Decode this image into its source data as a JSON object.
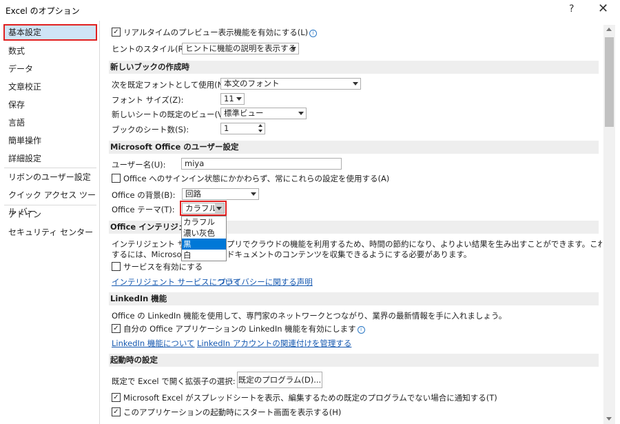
{
  "window": {
    "title": "Excel のオプション",
    "help": "?",
    "close": "✕"
  },
  "sidebar": {
    "items": [
      "基本設定",
      "数式",
      "データ",
      "文章校正",
      "保存",
      "言語",
      "簡単操作",
      "詳細設定",
      "リボンのユーザー設定",
      "クイック アクセス ツール バー",
      "アドイン",
      "セキュリティ センター"
    ],
    "selected": "基本設定"
  },
  "ui_options": {
    "live_preview": "リアルタイムのプレビュー表示機能を有効にする(L)",
    "tooltip_label": "ヒントのスタイル(R):",
    "tooltip_value": "ヒントに機能の説明を表示する"
  },
  "new_workbook": {
    "header": "新しいブックの作成時",
    "font_label": "次を既定フォントとして使用(N):",
    "font_value": "本文のフォント",
    "size_label": "フォント サイズ(Z):",
    "size_value": "11",
    "view_label": "新しいシートの既定のビュー(V):",
    "view_value": "標準ビュー",
    "sheets_label": "ブックのシート数(S):",
    "sheets_value": "1"
  },
  "personalize": {
    "header": "Microsoft Office のユーザー設定",
    "username_label": "ユーザー名(U):",
    "username_value": "miya",
    "always_use": "Office へのサインイン状態にかかわらず、常にこれらの設定を使用する(A)",
    "background_label": "Office の背景(B):",
    "background_value": "回路",
    "theme_label": "Office テーマ(T):",
    "theme_value": "カラフル",
    "theme_options": [
      "カラフル",
      "濃い灰色",
      "黒",
      "白"
    ],
    "theme_highlight": "黒"
  },
  "intelligent": {
    "header": "Office インテリジェント",
    "desc1a": "インテリジェント サービ",
    "desc1b": "プリでクラウドの機能を利用するため、時間の節約になり、よりよい結果を生み出すことができます。これらのサービスを提供",
    "desc2a": "するには、Microsoft",
    "desc2b": "ドキュメントのコンテンツを収集できるようにする必要があります。",
    "enable": "サービスを有効にする",
    "about_link": "インテリジェント サービスについて",
    "privacy_link": "プライバシーに関する声明"
  },
  "linkedin": {
    "header": "LinkedIn 機能",
    "desc": "Office の LinkedIn 機能を使用して、専門家のネットワークとつながり、業界の最新情報を手に入れましょう。",
    "enable": "自分の Office アプリケーションの LinkedIn 機能を有効にします",
    "about_link": "LinkedIn 機能について",
    "manage_link": "LinkedIn アカウントの関連付けを管理する"
  },
  "startup": {
    "header": "起動時の設定",
    "ext_label": "既定で Excel で開く拡張子の選択:",
    "default_programs": "既定のプログラム(D)...",
    "notify": "Microsoft Excel がスプレッドシートを表示、編集するための既定のプログラムでない場合に通知する(T)",
    "start_screen": "このアプリケーションの起動時にスタート画面を表示する(H)"
  },
  "checkbox_checked_glyph": "✓",
  "info_glyph": "i"
}
